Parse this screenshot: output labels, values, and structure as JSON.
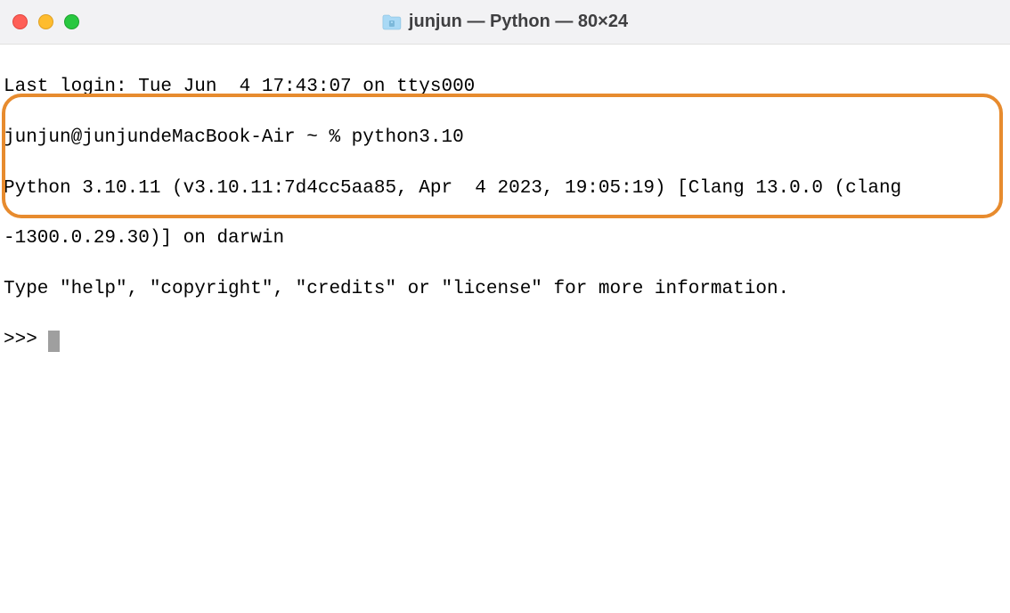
{
  "window": {
    "title": "junjun — Python — 80×24"
  },
  "terminal": {
    "line1": "Last login: Tue Jun  4 17:43:07 on ttys000",
    "line2": "junjun@junjundeMacBook-Air ~ % python3.10",
    "line3": "Python 3.10.11 (v3.10.11:7d4cc5aa85, Apr  4 2023, 19:05:19) [Clang 13.0.0 (clang",
    "line4": "-1300.0.29.30)] on darwin",
    "line5": "Type \"help\", \"copyright\", \"credits\" or \"license\" for more information.",
    "prompt": ">>> "
  }
}
